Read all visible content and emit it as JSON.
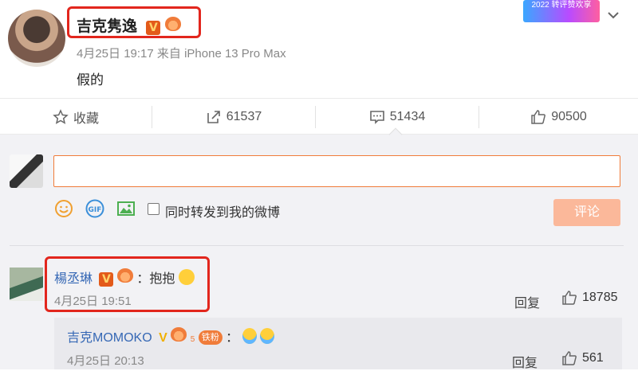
{
  "post": {
    "username": "吉克隽逸",
    "verified_badge": "V",
    "date": "4月25日 19:17",
    "source": "来自 iPhone 13 Pro Max",
    "text": "假的",
    "promo_text": "2022 转评赞欢享"
  },
  "actions": {
    "favorite_label": "收藏",
    "repost_count": "61537",
    "comment_count": "51434",
    "like_count": "90500"
  },
  "composer": {
    "input_value": "",
    "forward_label": "同时转发到我的微博",
    "submit_label": "评论",
    "gif_label": "GIF"
  },
  "comment": {
    "username": "楊丞琳",
    "verified_badge": "V",
    "text": "：抱抱",
    "time": "4月25日 19:51",
    "reply_label": "回复",
    "likes": "18785"
  },
  "reply": {
    "username": "吉克MOMOKO",
    "verified_badge": "V",
    "fan_badge": "铁粉",
    "fan_level": "5",
    "text": "：",
    "time": "4月25日 20:13",
    "reply_label": "回复",
    "likes": "561"
  },
  "colors": {
    "accent": "#f07c3a",
    "highlight_box": "#e2261d",
    "link": "#3668b5",
    "submit_disabled": "#fbb89a"
  }
}
